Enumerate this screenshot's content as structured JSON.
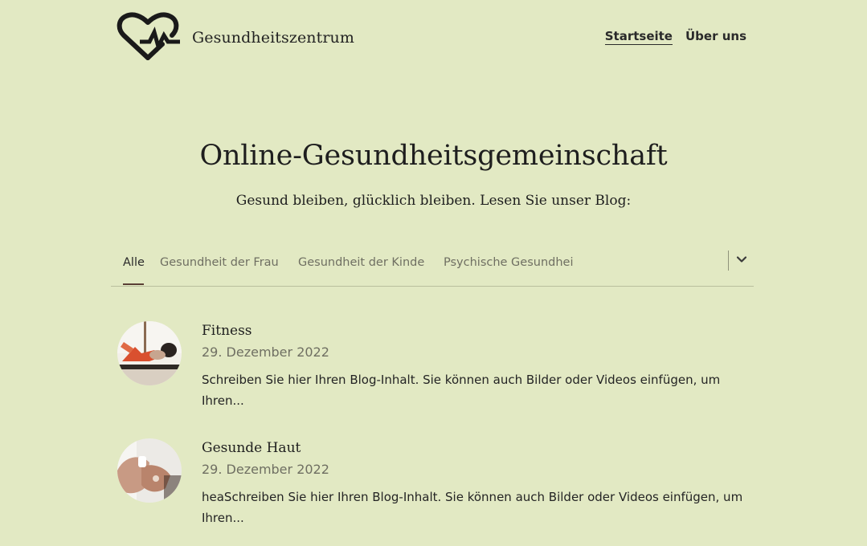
{
  "header": {
    "site_title": "Gesundheitszentrum",
    "logo_icon": "heart-pulse-icon",
    "nav": [
      {
        "label": "Startseite",
        "active": true
      },
      {
        "label": "Über uns",
        "active": false
      }
    ]
  },
  "hero": {
    "title": "Online-Gesundheitsgemeinschaft",
    "subtitle": "Gesund bleiben, glücklich bleiben. Lesen Sie unser Blog:"
  },
  "categories": {
    "items": [
      {
        "label": "Alle",
        "active": true
      },
      {
        "label": "Gesundheit der Frau",
        "active": false
      },
      {
        "label": "Gesundheit der Kinde",
        "active": false
      },
      {
        "label": "Psychische Gesundhei",
        "active": false
      }
    ],
    "more_icon": "chevron-down-icon"
  },
  "posts": [
    {
      "title": "Fitness",
      "date": "29. Dezember 2022",
      "excerpt": "Schreiben Sie hier Ihren Blog-Inhalt. Sie können auch Bilder oder Videos einfügen, um Ihren..."
    },
    {
      "title": "Gesunde Haut",
      "date": "29. Dezember 2022",
      "excerpt": "heaSchreiben Sie hier Ihren Blog-Inhalt. Sie können auch Bilder oder Videos einfügen, um Ihren..."
    }
  ],
  "colors": {
    "background": "#e2e9c3",
    "text": "#1e1e1e",
    "muted": "#6f6f62",
    "active_tab_underline": "#5a3f35"
  }
}
